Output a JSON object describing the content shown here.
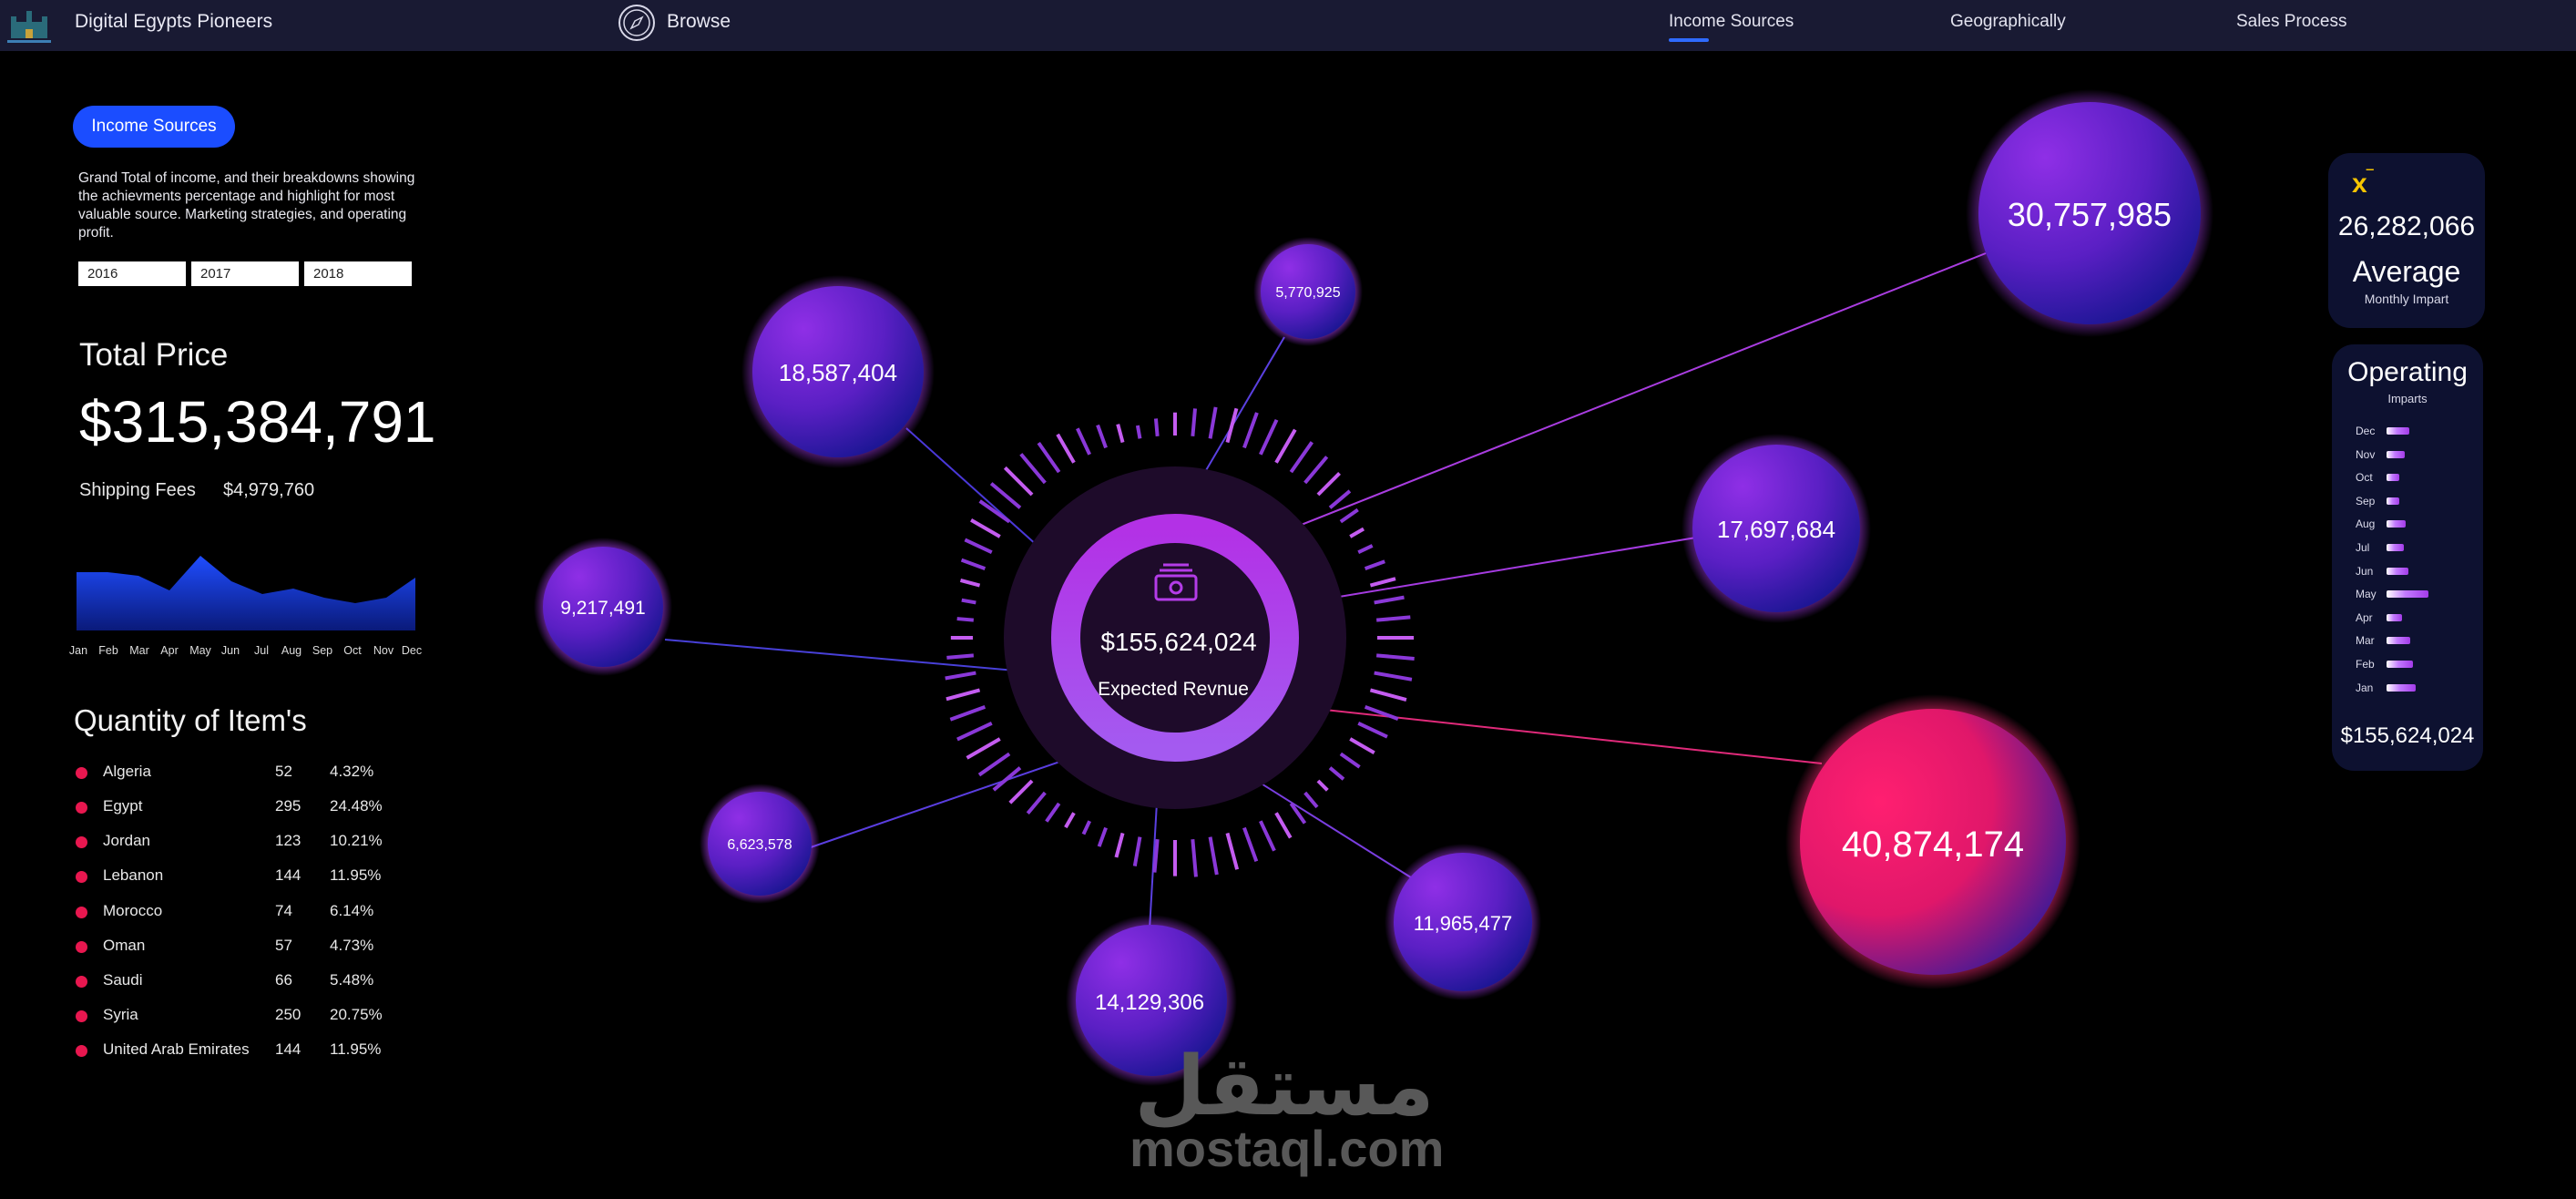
{
  "header": {
    "app_title": "Digital Egypts Pioneers",
    "logo_icon": "castle-logo-icon",
    "browse_icon": "compass-icon",
    "browse_label": "Browse",
    "tabs": [
      {
        "label": "Income Sources",
        "active": true
      },
      {
        "label": "Geographically",
        "active": false
      },
      {
        "label": "Sales Process",
        "active": false
      }
    ]
  },
  "sidebar": {
    "pill_label": "Income Sources",
    "description": "Grand Total of income, and their breakdowns showing the achievments percentage and highlight for most valuable source. Marketing strategies, and operating profit.",
    "years": [
      "2016",
      "2017",
      "2018"
    ],
    "total_label": "Total Price",
    "total_value": "$315,384,791",
    "shipping_label": "Shipping Fees",
    "shipping_value": "$4,979,760",
    "months": [
      "Jan",
      "Feb",
      "Mar",
      "Apr",
      "May",
      "Jun",
      "Jul",
      "Aug",
      "Sep",
      "Oct",
      "Nov",
      "Dec"
    ],
    "quantity_title": "Quantity of Item's",
    "quantity_rows": [
      {
        "country": "Algeria",
        "count": "52",
        "pct": "4.32%"
      },
      {
        "country": "Egypt",
        "count": "295",
        "pct": "24.48%"
      },
      {
        "country": "Jordan",
        "count": "123",
        "pct": "10.21%"
      },
      {
        "country": "Lebanon",
        "count": "144",
        "pct": "11.95%"
      },
      {
        "country": "Morocco",
        "count": "74",
        "pct": "6.14%"
      },
      {
        "country": "Oman",
        "count": "57",
        "pct": "4.73%"
      },
      {
        "country": "Saudi",
        "count": "66",
        "pct": "5.48%"
      },
      {
        "country": "Syria",
        "count": "250",
        "pct": "20.75%"
      },
      {
        "country": "United Arab Emirates",
        "count": "144",
        "pct": "11.95%"
      }
    ]
  },
  "center": {
    "value": "$155,624,024",
    "label": "Expected Revnue",
    "icon": "money-icon"
  },
  "bubbles": [
    {
      "label": "30,757,985"
    },
    {
      "label": "18,587,404"
    },
    {
      "label": "5,770,925"
    },
    {
      "label": "17,697,684"
    },
    {
      "label": "9,217,491"
    },
    {
      "label": "40,874,174"
    },
    {
      "label": "6,623,578"
    },
    {
      "label": "11,965,477"
    },
    {
      "label": "14,129,306"
    }
  ],
  "average_card": {
    "icon": "fx-icon",
    "icon_text": "x",
    "value": "26,282,066",
    "title": "Average",
    "subtitle": "Monthly Impart"
  },
  "operating_card": {
    "title": "Operating",
    "subtitle": "Imparts",
    "rows": [
      {
        "month": "Dec",
        "level": 0.52
      },
      {
        "month": "Nov",
        "level": 0.42
      },
      {
        "month": "Oct",
        "level": 0.3
      },
      {
        "month": "Sep",
        "level": 0.3
      },
      {
        "month": "Aug",
        "level": 0.44
      },
      {
        "month": "Jul",
        "level": 0.4
      },
      {
        "month": "Jun",
        "level": 0.5
      },
      {
        "month": "May",
        "level": 0.95
      },
      {
        "month": "Apr",
        "level": 0.36
      },
      {
        "month": "Mar",
        "level": 0.54
      },
      {
        "month": "Feb",
        "level": 0.6
      },
      {
        "month": "Jan",
        "level": 0.66
      }
    ],
    "total": "$155,624,024"
  },
  "colors": {
    "accent": "#1b4dff",
    "bubble_top": "#8a2be2",
    "bubble_bottom": "#14148c",
    "highlight": "#ff1a6e",
    "ring": "#b43ce8",
    "dot": "#e8174f",
    "fx": "#f5c400"
  },
  "watermark": {
    "arabic": "مستقل",
    "latin": "mostaql.com"
  }
}
